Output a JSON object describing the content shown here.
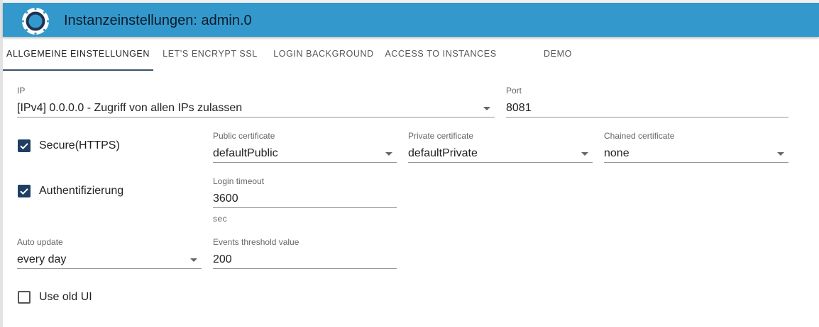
{
  "header": {
    "title": "Instanzeinstellungen: admin.0",
    "logo_icon": "iobroker-logo-icon",
    "color": "#3399cc"
  },
  "tabs": [
    {
      "label": "ALLGEMEINE EINSTELLUNGEN",
      "active": true
    },
    {
      "label": "LET'S ENCRYPT SSL",
      "active": false
    },
    {
      "label": "LOGIN BACKGROUND",
      "active": false
    },
    {
      "label": "ACCESS TO INSTANCES",
      "active": false
    },
    {
      "label": "DEMO",
      "active": false
    }
  ],
  "form": {
    "ip": {
      "label": "IP",
      "value": "[IPv4] 0.0.0.0 - Zugriff von allen IPs zulassen"
    },
    "port": {
      "label": "Port",
      "value": "8081"
    },
    "secure": {
      "label": "Secure(HTTPS)",
      "checked": true
    },
    "public_certificate": {
      "label": "Public certificate",
      "value": "defaultPublic"
    },
    "private_certificate": {
      "label": "Private certificate",
      "value": "defaultPrivate"
    },
    "chained_certificate": {
      "label": "Chained certificate",
      "value": "none"
    },
    "authentication": {
      "label": "Authentifizierung",
      "checked": true
    },
    "login_timeout": {
      "label": "Login timeout",
      "value": "3600",
      "helper": "sec"
    },
    "auto_update": {
      "label": "Auto update",
      "value": "every day"
    },
    "events_threshold": {
      "label": "Events threshold value",
      "value": "200"
    },
    "old_ui": {
      "label": "Use old UI",
      "checked": false
    }
  }
}
